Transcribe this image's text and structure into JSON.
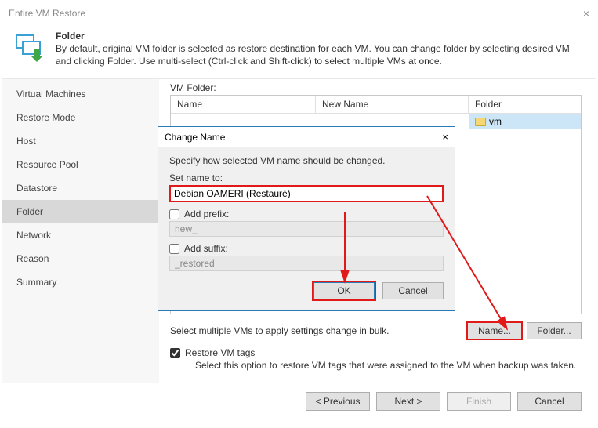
{
  "window": {
    "title": "Entire VM Restore",
    "close": "×"
  },
  "header": {
    "title": "Folder",
    "desc": "By default, original VM folder is selected as restore destination for each VM. You can change folder by selecting desired VM and clicking Folder. Use multi-select (Ctrl-click and Shift-click) to select multiple VMs at once."
  },
  "sidebar": {
    "items": [
      {
        "label": "Virtual Machines"
      },
      {
        "label": "Restore Mode"
      },
      {
        "label": "Host"
      },
      {
        "label": "Resource Pool"
      },
      {
        "label": "Datastore"
      },
      {
        "label": "Folder"
      },
      {
        "label": "Network"
      },
      {
        "label": "Reason"
      },
      {
        "label": "Summary"
      }
    ],
    "active_index": 5
  },
  "main": {
    "vm_folder_label": "VM Folder:",
    "columns": {
      "name": "Name",
      "new_name": "New Name",
      "folder": "Folder"
    },
    "rows": [
      {
        "name": "",
        "new_name": "",
        "folder": "vm"
      }
    ],
    "bulk_text": "Select multiple VMs to apply settings change in bulk.",
    "name_btn": "Name...",
    "folder_btn": "Folder...",
    "restore_tags_label": "Restore VM tags",
    "restore_tags_checked": true,
    "restore_tags_desc": "Select this option to restore VM tags that were assigned to the VM when backup was taken."
  },
  "dialog": {
    "title": "Change Name",
    "close": "×",
    "instruction": "Specify how selected VM name should be changed.",
    "set_name_label": "Set name to:",
    "name_value": "Debian OAMERI (Restauré)",
    "add_prefix_label": "Add prefix:",
    "prefix_value": "new_",
    "add_suffix_label": "Add suffix:",
    "suffix_value": "_restored",
    "ok": "OK",
    "cancel": "Cancel"
  },
  "footer": {
    "previous": "< Previous",
    "next": "Next >",
    "finish": "Finish",
    "cancel": "Cancel"
  }
}
